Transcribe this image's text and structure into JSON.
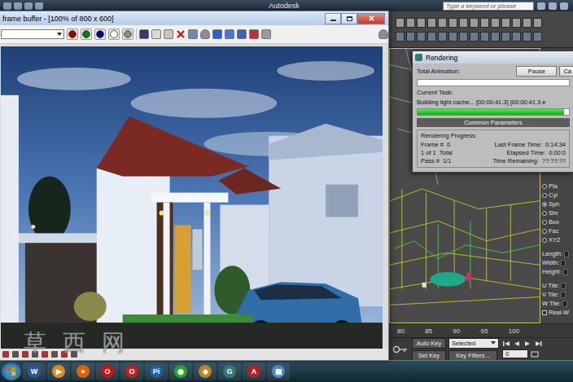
{
  "app": {
    "title": "Autodesk",
    "search_placeholder": "Type a keyword or phrase"
  },
  "frame_buffer": {
    "title": "frame buffer - [100% of 800 x 600]",
    "channels": [
      {
        "color": "#9a0000"
      },
      {
        "color": "#007a00"
      },
      {
        "color": "#00008a"
      },
      {
        "color": "#ffffff"
      },
      {
        "color": "#8a8a8a"
      }
    ],
    "watermark": "草 西 网"
  },
  "render_dialog": {
    "title": "Rendering",
    "total_label": "Total Animation:",
    "total_level": 0,
    "buttons": [
      "Pause",
      "Ca"
    ],
    "task_label": "Current Task:",
    "task": "Building light cache... [00:00:41.3] [00:00:41.3 e",
    "task_level": 0.97,
    "group_title": "Common Parameters",
    "progress_label": "Rendering Progress:",
    "left_fields": [
      {
        "label": "Frame #",
        "value": "0"
      },
      {
        "label": "1 of 1",
        "value": "Total"
      },
      {
        "label": "Pass #",
        "value": "1/1"
      }
    ],
    "right_fields": [
      {
        "label": "Last Frame Time:",
        "value": "0:14:34"
      },
      {
        "label": "Elapsed Time:",
        "value": "0:00:0"
      },
      {
        "label": "Time Remaining:",
        "value": "??:??:??"
      }
    ]
  },
  "mapping_panel": {
    "options": [
      {
        "label": "Pla",
        "selected": false
      },
      {
        "label": "Cyl",
        "selected": false
      },
      {
        "label": "Sph",
        "selected": true
      },
      {
        "label": "Shr",
        "selected": false
      },
      {
        "label": "Box",
        "selected": false
      },
      {
        "label": "Fac",
        "selected": false
      },
      {
        "label": "XYZ",
        "selected": false
      }
    ],
    "size_fields": [
      "Length:",
      "Width:",
      "Height:"
    ],
    "tile_fields": [
      "U Tile:",
      "V Tile:",
      "W Tile:"
    ],
    "real_world": {
      "label": "Real-W",
      "checked": false
    }
  },
  "timeline": {
    "ticks": [
      "80",
      "85",
      "90",
      "95",
      "100"
    ]
  },
  "key_controls": {
    "auto_key": "Auto Key",
    "key_mode": "Selected",
    "set_key": "Set Key",
    "key_filters": "Key Filters...",
    "frame": "0"
  },
  "taskbar": {
    "apps": [
      {
        "glyph": "W",
        "color": "#2b5797"
      },
      {
        "glyph": "▶",
        "color": "#e08a1e"
      },
      {
        "glyph": "●",
        "color": "#e66000"
      },
      {
        "glyph": "O",
        "color": "#cc1016"
      },
      {
        "glyph": "O",
        "color": "#c41e1e"
      },
      {
        "glyph": "Pi",
        "color": "#1f5fa8"
      },
      {
        "glyph": "◉",
        "color": "#2aa52a"
      },
      {
        "glyph": "◆",
        "color": "#b8862a"
      },
      {
        "glyph": "G",
        "color": "#2f7a78"
      },
      {
        "glyph": "A",
        "color": "#b02020"
      },
      {
        "glyph": "▣",
        "color": "#4a8ac0"
      }
    ]
  }
}
